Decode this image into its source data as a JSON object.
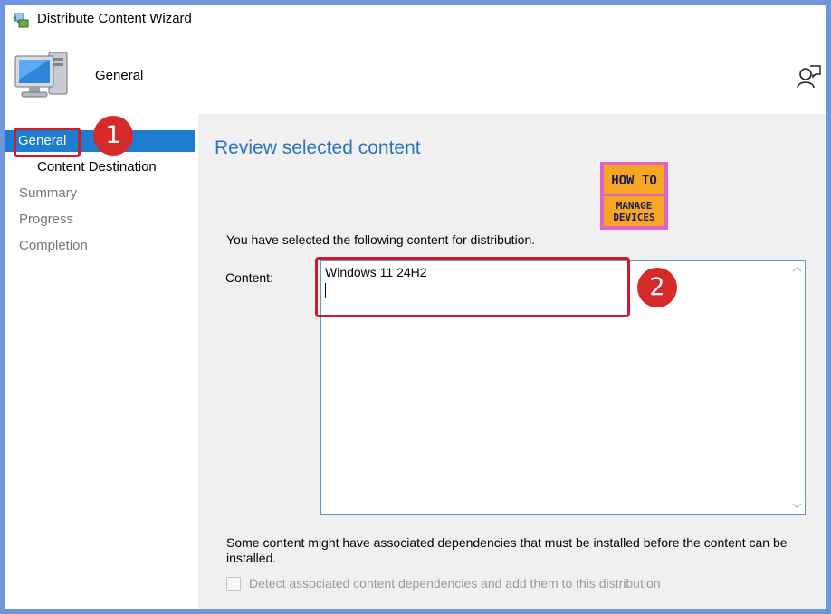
{
  "window": {
    "title": "Distribute Content Wizard"
  },
  "header": {
    "heading": "General"
  },
  "sidebar": {
    "items": [
      {
        "label": "General",
        "state": "active"
      },
      {
        "label": "Content Destination",
        "state": "sub"
      },
      {
        "label": "Summary",
        "state": "disabled"
      },
      {
        "label": "Progress",
        "state": "disabled"
      },
      {
        "label": "Completion",
        "state": "disabled"
      }
    ]
  },
  "main": {
    "section_title": "Review selected content",
    "intro": "You have selected the following content for distribution.",
    "content_label": "Content:",
    "content_value": "Windows 11 24H2",
    "note": "Some content might have associated dependencies that must be installed before the content can be installed.",
    "checkbox_label": "Detect associated content dependencies and add them to this distribution",
    "checkbox_checked": false
  },
  "watermark": {
    "line1": "HOW TO",
    "line2": "MANAGE",
    "line3": "DEVICES"
  },
  "annotations": {
    "badge1": "1",
    "badge2": "2"
  },
  "colors": {
    "accent": "#1e7cd1",
    "title_blue": "#2a73c2",
    "callout_red": "#d01a2a",
    "frame": "#6f95dc"
  }
}
